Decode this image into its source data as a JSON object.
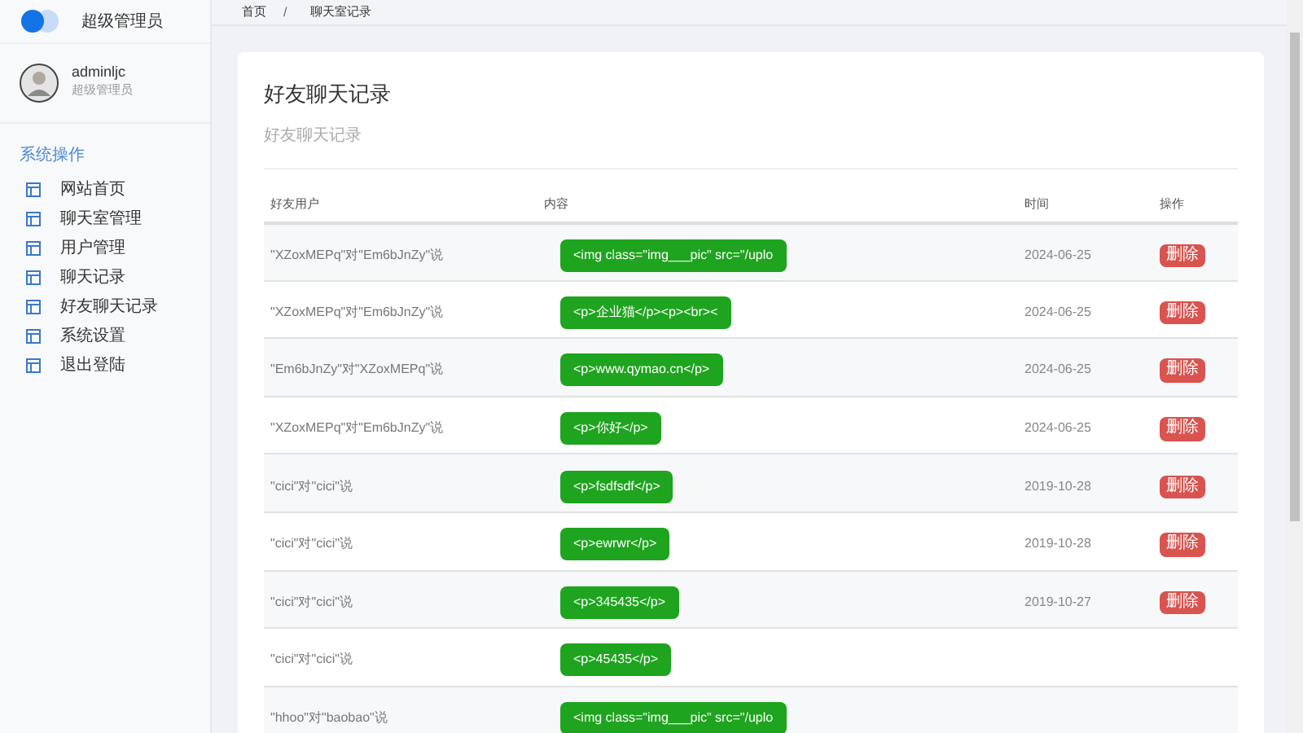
{
  "brand": {
    "title": "超级管理员"
  },
  "user": {
    "name": "adminljc",
    "role": "超级管理员"
  },
  "sidebar": {
    "section": "系统操作",
    "items": [
      {
        "label": "网站首页"
      },
      {
        "label": "聊天室管理"
      },
      {
        "label": "用户管理"
      },
      {
        "label": "聊天记录"
      },
      {
        "label": "好友聊天记录"
      },
      {
        "label": "系统设置"
      },
      {
        "label": "退出登陆"
      }
    ]
  },
  "breadcrumb": [
    "首页",
    "聊天室记录"
  ],
  "breadcrumb_separator": "/",
  "card": {
    "title": "好友聊天记录",
    "subtitle": "好友聊天记录"
  },
  "table": {
    "columns": [
      "好友用户",
      "内容",
      "时间",
      "操作"
    ],
    "rows": [
      {
        "user": "\"XZoxMEPq\"对\"Em6bJnZy\"说",
        "content": "<img class=\"img___pic\" src=\"/uplo",
        "time": "2024-06-25",
        "action": "删除"
      },
      {
        "user": "\"XZoxMEPq\"对\"Em6bJnZy\"说",
        "content": "<p>企业猫</p><p><br><",
        "time": "2024-06-25",
        "action": "删除"
      },
      {
        "user": "\"Em6bJnZy\"对\"XZoxMEPq\"说",
        "content": "<p>www.qymao.cn</p>",
        "time": "2024-06-25",
        "action": "删除"
      },
      {
        "user": "\"XZoxMEPq\"对\"Em6bJnZy\"说",
        "content": "<p>你好</p>",
        "time": "2024-06-25",
        "action": "删除"
      },
      {
        "user": "\"cici\"对\"cici\"说",
        "content": "<p>fsdfsdf</p>",
        "time": "2019-10-28",
        "action": "删除"
      },
      {
        "user": "\"cici\"对\"cici\"说",
        "content": "<p>ewrwr</p>",
        "time": "2019-10-28",
        "action": "删除"
      },
      {
        "user": "\"cici\"对\"cici\"说",
        "content": "<p>345435</p>",
        "time": "2019-10-27",
        "action": "删除"
      },
      {
        "user": "\"cici\"对\"cici\"说",
        "content": "<p>45435</p>"
      },
      {
        "user": "\"hhoo\"对\"baobao\"说",
        "content": "<img class=\"img___pic\" src=\"/uplo"
      }
    ]
  }
}
